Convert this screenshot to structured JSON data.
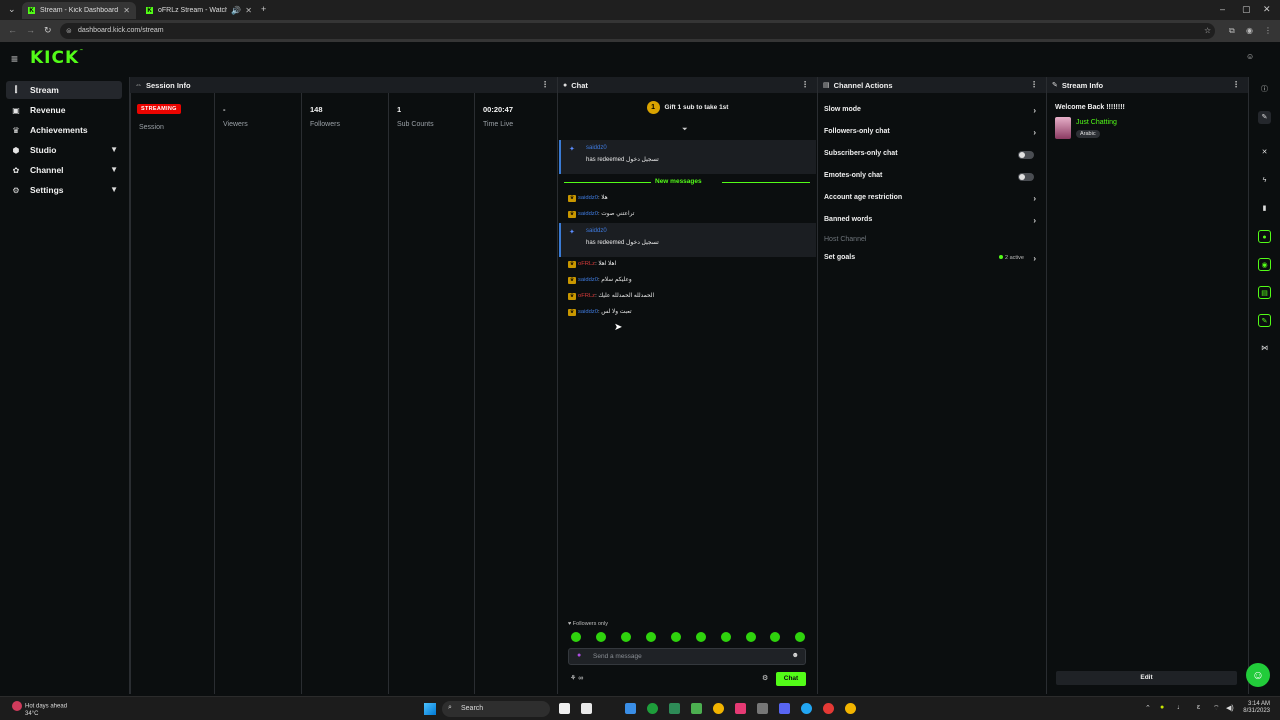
{
  "browser": {
    "tabs": [
      {
        "title": "Stream - Kick Dashboard",
        "active": true
      },
      {
        "title": "oFRLz Stream - Watch Live",
        "active": false
      }
    ],
    "url": "dashboard.kick.com/stream"
  },
  "brand": {
    "logo": "KICK",
    "accent": "#53fc18"
  },
  "sidebar": {
    "items": [
      {
        "label": "Stream",
        "icon": "stream-icon",
        "active": true
      },
      {
        "label": "Revenue",
        "icon": "dollar-icon"
      },
      {
        "label": "Achievements",
        "icon": "trophy-icon"
      },
      {
        "label": "Studio",
        "icon": "studio-icon",
        "expandable": true
      },
      {
        "label": "Channel",
        "icon": "channel-icon",
        "expandable": true
      },
      {
        "label": "Settings",
        "icon": "gear-icon",
        "expandable": true
      }
    ]
  },
  "session": {
    "title": "Session Info",
    "badge": "STREAMING",
    "stats": [
      {
        "value": "",
        "label": "Session"
      },
      {
        "value": "-",
        "label": "Viewers"
      },
      {
        "value": "148",
        "label": "Followers"
      },
      {
        "value": "1",
        "label": "Sub Counts"
      },
      {
        "value": "00:20:47",
        "label": "Time Live"
      }
    ]
  },
  "chat": {
    "title": "Chat",
    "pinned_badge": "1",
    "pinned": "Gift 1 sub to take 1st",
    "redeems": [
      {
        "user": "saiddz0",
        "text": "has redeemed تسجيل دخول"
      },
      {
        "user": "saiddz0",
        "text": "has redeemed تسجيل دخول"
      }
    ],
    "new_messages": "New messages",
    "messages": [
      {
        "user": "saiddz0",
        "color": "blue",
        "text": ": هلا"
      },
      {
        "user": "saiddz0",
        "color": "blue",
        "text": ": تراعتني صوت"
      },
      {
        "user": "oFRLz",
        "color": "red",
        "text": ": اهلا اهلا"
      },
      {
        "user": "saiddz0",
        "color": "blue",
        "text": ": وعليكم سلام"
      },
      {
        "user": "oFRLz",
        "color": "red",
        "text": ": الحمدلله الحمدلله عليك"
      },
      {
        "user": "saiddz0",
        "color": "blue",
        "text": ": تعبت ولا لس"
      }
    ],
    "followers_only": "Followers only",
    "input_placeholder": "Send a message",
    "send_label": "Chat"
  },
  "channel_actions": {
    "title": "Channel Actions",
    "rows": [
      {
        "label": "Slow mode",
        "type": "arrow"
      },
      {
        "label": "Followers-only chat",
        "type": "arrow"
      },
      {
        "label": "Subscribers-only chat",
        "type": "toggle"
      },
      {
        "label": "Emotes-only chat",
        "type": "toggle"
      },
      {
        "label": "Account age restriction",
        "type": "arrow"
      },
      {
        "label": "Banned words",
        "type": "arrow"
      },
      {
        "label": "Host Channel",
        "type": "muted"
      },
      {
        "label": "Set goals",
        "type": "arrow",
        "status": "2 active"
      }
    ]
  },
  "stream_info": {
    "title": "Stream Info",
    "welcome": "Welcome Back !!!!!!!!",
    "category": "Just Chatting",
    "tag": "Arabic",
    "edit_label": "Edit"
  },
  "taskbar": {
    "weather_title": "Hot days ahead",
    "weather_temp": "34°C",
    "search": "Search",
    "time": "3:14 AM",
    "date": "8/31/2023"
  }
}
